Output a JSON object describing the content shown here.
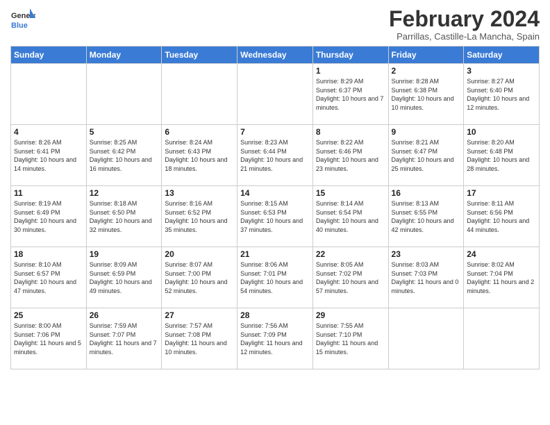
{
  "header": {
    "logo_general": "General",
    "logo_blue": "Blue",
    "month_title": "February 2024",
    "subtitle": "Parrillas, Castille-La Mancha, Spain"
  },
  "days_of_week": [
    "Sunday",
    "Monday",
    "Tuesday",
    "Wednesday",
    "Thursday",
    "Friday",
    "Saturday"
  ],
  "weeks": [
    [
      {
        "day": "",
        "info": ""
      },
      {
        "day": "",
        "info": ""
      },
      {
        "day": "",
        "info": ""
      },
      {
        "day": "",
        "info": ""
      },
      {
        "day": "1",
        "info": "Sunrise: 8:29 AM\nSunset: 6:37 PM\nDaylight: 10 hours and 7 minutes."
      },
      {
        "day": "2",
        "info": "Sunrise: 8:28 AM\nSunset: 6:38 PM\nDaylight: 10 hours and 10 minutes."
      },
      {
        "day": "3",
        "info": "Sunrise: 8:27 AM\nSunset: 6:40 PM\nDaylight: 10 hours and 12 minutes."
      }
    ],
    [
      {
        "day": "4",
        "info": "Sunrise: 8:26 AM\nSunset: 6:41 PM\nDaylight: 10 hours and 14 minutes."
      },
      {
        "day": "5",
        "info": "Sunrise: 8:25 AM\nSunset: 6:42 PM\nDaylight: 10 hours and 16 minutes."
      },
      {
        "day": "6",
        "info": "Sunrise: 8:24 AM\nSunset: 6:43 PM\nDaylight: 10 hours and 18 minutes."
      },
      {
        "day": "7",
        "info": "Sunrise: 8:23 AM\nSunset: 6:44 PM\nDaylight: 10 hours and 21 minutes."
      },
      {
        "day": "8",
        "info": "Sunrise: 8:22 AM\nSunset: 6:46 PM\nDaylight: 10 hours and 23 minutes."
      },
      {
        "day": "9",
        "info": "Sunrise: 8:21 AM\nSunset: 6:47 PM\nDaylight: 10 hours and 25 minutes."
      },
      {
        "day": "10",
        "info": "Sunrise: 8:20 AM\nSunset: 6:48 PM\nDaylight: 10 hours and 28 minutes."
      }
    ],
    [
      {
        "day": "11",
        "info": "Sunrise: 8:19 AM\nSunset: 6:49 PM\nDaylight: 10 hours and 30 minutes."
      },
      {
        "day": "12",
        "info": "Sunrise: 8:18 AM\nSunset: 6:50 PM\nDaylight: 10 hours and 32 minutes."
      },
      {
        "day": "13",
        "info": "Sunrise: 8:16 AM\nSunset: 6:52 PM\nDaylight: 10 hours and 35 minutes."
      },
      {
        "day": "14",
        "info": "Sunrise: 8:15 AM\nSunset: 6:53 PM\nDaylight: 10 hours and 37 minutes."
      },
      {
        "day": "15",
        "info": "Sunrise: 8:14 AM\nSunset: 6:54 PM\nDaylight: 10 hours and 40 minutes."
      },
      {
        "day": "16",
        "info": "Sunrise: 8:13 AM\nSunset: 6:55 PM\nDaylight: 10 hours and 42 minutes."
      },
      {
        "day": "17",
        "info": "Sunrise: 8:11 AM\nSunset: 6:56 PM\nDaylight: 10 hours and 44 minutes."
      }
    ],
    [
      {
        "day": "18",
        "info": "Sunrise: 8:10 AM\nSunset: 6:57 PM\nDaylight: 10 hours and 47 minutes."
      },
      {
        "day": "19",
        "info": "Sunrise: 8:09 AM\nSunset: 6:59 PM\nDaylight: 10 hours and 49 minutes."
      },
      {
        "day": "20",
        "info": "Sunrise: 8:07 AM\nSunset: 7:00 PM\nDaylight: 10 hours and 52 minutes."
      },
      {
        "day": "21",
        "info": "Sunrise: 8:06 AM\nSunset: 7:01 PM\nDaylight: 10 hours and 54 minutes."
      },
      {
        "day": "22",
        "info": "Sunrise: 8:05 AM\nSunset: 7:02 PM\nDaylight: 10 hours and 57 minutes."
      },
      {
        "day": "23",
        "info": "Sunrise: 8:03 AM\nSunset: 7:03 PM\nDaylight: 11 hours and 0 minutes."
      },
      {
        "day": "24",
        "info": "Sunrise: 8:02 AM\nSunset: 7:04 PM\nDaylight: 11 hours and 2 minutes."
      }
    ],
    [
      {
        "day": "25",
        "info": "Sunrise: 8:00 AM\nSunset: 7:06 PM\nDaylight: 11 hours and 5 minutes."
      },
      {
        "day": "26",
        "info": "Sunrise: 7:59 AM\nSunset: 7:07 PM\nDaylight: 11 hours and 7 minutes."
      },
      {
        "day": "27",
        "info": "Sunrise: 7:57 AM\nSunset: 7:08 PM\nDaylight: 11 hours and 10 minutes."
      },
      {
        "day": "28",
        "info": "Sunrise: 7:56 AM\nSunset: 7:09 PM\nDaylight: 11 hours and 12 minutes."
      },
      {
        "day": "29",
        "info": "Sunrise: 7:55 AM\nSunset: 7:10 PM\nDaylight: 11 hours and 15 minutes."
      },
      {
        "day": "",
        "info": ""
      },
      {
        "day": "",
        "info": ""
      }
    ]
  ]
}
